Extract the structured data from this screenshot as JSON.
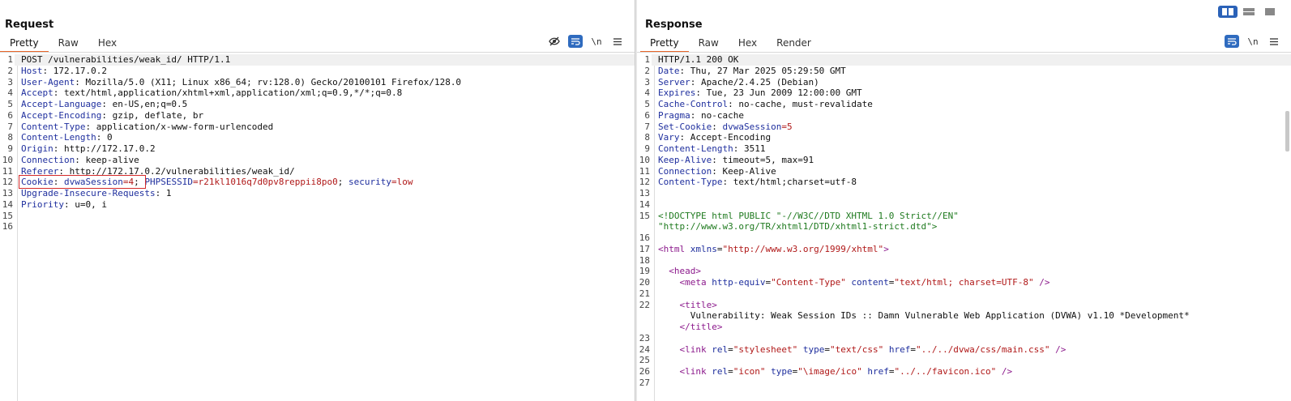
{
  "layout_toggle": [
    "split-horizontal",
    "split-vertical",
    "tabbed"
  ],
  "request": {
    "title": "Request",
    "tabs": [
      "Pretty",
      "Raw",
      "Hex"
    ],
    "active_tab": "Pretty",
    "tools": [
      "eye-slash-icon",
      "wrap-icon",
      "\\n",
      "menu-icon"
    ],
    "newline_label": "\\n",
    "lines": [
      {
        "n": "1",
        "parts": [
          {
            "t": "POST /vulnerabilities/weak_id/ HTTP/1.1",
            "c": "hv"
          }
        ]
      },
      {
        "n": "2",
        "parts": [
          {
            "t": "Host",
            "c": "hk"
          },
          {
            "t": ": 172.17.0.2",
            "c": "hv"
          }
        ]
      },
      {
        "n": "3",
        "parts": [
          {
            "t": "User-Agent",
            "c": "hk"
          },
          {
            "t": ": Mozilla/5.0 (X11; Linux x86_64; rv:128.0) Gecko/20100101 Firefox/128.0",
            "c": "hv"
          }
        ]
      },
      {
        "n": "4",
        "parts": [
          {
            "t": "Accept",
            "c": "hk"
          },
          {
            "t": ": text/html,application/xhtml+xml,application/xml;q=0.9,*/*;q=0.8",
            "c": "hv"
          }
        ]
      },
      {
        "n": "5",
        "parts": [
          {
            "t": "Accept-Language",
            "c": "hk"
          },
          {
            "t": ": en-US,en;q=0.5",
            "c": "hv"
          }
        ]
      },
      {
        "n": "6",
        "parts": [
          {
            "t": "Accept-Encoding",
            "c": "hk"
          },
          {
            "t": ": gzip, deflate, br",
            "c": "hv"
          }
        ]
      },
      {
        "n": "7",
        "parts": [
          {
            "t": "Content-Type",
            "c": "hk"
          },
          {
            "t": ": application/x-www-form-urlencoded",
            "c": "hv"
          }
        ]
      },
      {
        "n": "8",
        "parts": [
          {
            "t": "Content-Length",
            "c": "hk"
          },
          {
            "t": ": 0",
            "c": "hv"
          }
        ]
      },
      {
        "n": "9",
        "parts": [
          {
            "t": "Origin",
            "c": "hk"
          },
          {
            "t": ": http://172.17.0.2",
            "c": "hv"
          }
        ]
      },
      {
        "n": "10",
        "parts": [
          {
            "t": "Connection",
            "c": "hk"
          },
          {
            "t": ": keep-alive",
            "c": "hv"
          }
        ]
      },
      {
        "n": "11",
        "parts": [
          {
            "t": "Referer",
            "c": "hk"
          },
          {
            "t": ": http://172.17.0.2/vulnerabilities/weak_id/",
            "c": "hv"
          }
        ]
      },
      {
        "n": "12",
        "parts": [
          {
            "t": "Cookie",
            "c": "hk"
          },
          {
            "t": ": ",
            "c": "hv"
          },
          {
            "t": "dvwaSession",
            "c": "ck"
          },
          {
            "t": "=4",
            "c": "cv"
          },
          {
            "t": "; ",
            "c": "hv"
          },
          {
            "t": "PHPSESSID",
            "c": "ck"
          },
          {
            "t": "=r21kl1016q7d0pv8reppii8po0",
            "c": "cv"
          },
          {
            "t": "; ",
            "c": "hv"
          },
          {
            "t": "security",
            "c": "ck"
          },
          {
            "t": "=low",
            "c": "cv"
          }
        ]
      },
      {
        "n": "13",
        "parts": [
          {
            "t": "Upgrade-Insecure-Requests",
            "c": "hk"
          },
          {
            "t": ": 1",
            "c": "hv"
          }
        ]
      },
      {
        "n": "14",
        "parts": [
          {
            "t": "Priority",
            "c": "hk"
          },
          {
            "t": ": u=0, i",
            "c": "hv"
          }
        ]
      },
      {
        "n": "15",
        "parts": []
      },
      {
        "n": "16",
        "parts": []
      }
    ]
  },
  "response": {
    "title": "Response",
    "tabs": [
      "Pretty",
      "Raw",
      "Hex",
      "Render"
    ],
    "active_tab": "Pretty",
    "tools": [
      "wrap-icon",
      "\\n",
      "menu-icon"
    ],
    "newline_label": "\\n",
    "lines": [
      {
        "n": "1",
        "parts": [
          {
            "t": "HTTP/1.1 200 OK",
            "c": "hv"
          }
        ]
      },
      {
        "n": "2",
        "parts": [
          {
            "t": "Date",
            "c": "hk"
          },
          {
            "t": ": Thu, 27 Mar 2025 05:29:50 GMT",
            "c": "hv"
          }
        ]
      },
      {
        "n": "3",
        "parts": [
          {
            "t": "Server",
            "c": "hk"
          },
          {
            "t": ": Apache/2.4.25 (Debian)",
            "c": "hv"
          }
        ]
      },
      {
        "n": "4",
        "parts": [
          {
            "t": "Expires",
            "c": "hk"
          },
          {
            "t": ": Tue, 23 Jun 2009 12:00:00 GMT",
            "c": "hv"
          }
        ]
      },
      {
        "n": "5",
        "parts": [
          {
            "t": "Cache-Control",
            "c": "hk"
          },
          {
            "t": ": no-cache, must-revalidate",
            "c": "hv"
          }
        ]
      },
      {
        "n": "6",
        "parts": [
          {
            "t": "Pragma",
            "c": "hk"
          },
          {
            "t": ": no-cache",
            "c": "hv"
          }
        ]
      },
      {
        "n": "7",
        "parts": [
          {
            "t": "Set-Cookie",
            "c": "hk"
          },
          {
            "t": ": ",
            "c": "hv"
          },
          {
            "t": "dvwaSession",
            "c": "ck"
          },
          {
            "t": "=5",
            "c": "cv"
          }
        ]
      },
      {
        "n": "8",
        "parts": [
          {
            "t": "Vary",
            "c": "hk"
          },
          {
            "t": ": Accept-Encoding",
            "c": "hv"
          }
        ]
      },
      {
        "n": "9",
        "parts": [
          {
            "t": "Content-Length",
            "c": "hk"
          },
          {
            "t": ": 3511",
            "c": "hv"
          }
        ]
      },
      {
        "n": "10",
        "parts": [
          {
            "t": "Keep-Alive",
            "c": "hk"
          },
          {
            "t": ": timeout=5, max=91",
            "c": "hv"
          }
        ]
      },
      {
        "n": "11",
        "parts": [
          {
            "t": "Connection",
            "c": "hk"
          },
          {
            "t": ": Keep-Alive",
            "c": "hv"
          }
        ]
      },
      {
        "n": "12",
        "parts": [
          {
            "t": "Content-Type",
            "c": "hk"
          },
          {
            "t": ": text/html;charset=utf-8",
            "c": "hv"
          }
        ]
      },
      {
        "n": "13",
        "parts": []
      },
      {
        "n": "14",
        "parts": []
      },
      {
        "n": "15",
        "parts": [
          {
            "t": "<!DOCTYPE html PUBLIC \"-//W3C//DTD XHTML 1.0 Strict//EN\"",
            "c": "doc"
          }
        ]
      },
      {
        "n": "",
        "parts": [
          {
            "t": "\"http://www.w3.org/TR/xhtml1/DTD/xhtml1-strict.dtd\">",
            "c": "doc"
          }
        ]
      },
      {
        "n": "16",
        "parts": []
      },
      {
        "n": "17",
        "parts": [
          {
            "t": "<html ",
            "c": "tag"
          },
          {
            "t": "xmlns",
            "c": "attr"
          },
          {
            "t": "=",
            "c": "hv"
          },
          {
            "t": "\"http://www.w3.org/1999/xhtml\"",
            "c": "str"
          },
          {
            "t": ">",
            "c": "tag"
          }
        ]
      },
      {
        "n": "18",
        "parts": []
      },
      {
        "n": "19",
        "parts": [
          {
            "t": "  <head>",
            "c": "tag"
          }
        ]
      },
      {
        "n": "20",
        "parts": [
          {
            "t": "    <meta ",
            "c": "tag"
          },
          {
            "t": "http-equiv",
            "c": "attr"
          },
          {
            "t": "=",
            "c": "hv"
          },
          {
            "t": "\"Content-Type\"",
            "c": "str"
          },
          {
            "t": " content",
            "c": "attr"
          },
          {
            "t": "=",
            "c": "hv"
          },
          {
            "t": "\"text/html; charset=UTF-8\"",
            "c": "str"
          },
          {
            "t": " />",
            "c": "tag"
          }
        ]
      },
      {
        "n": "21",
        "parts": []
      },
      {
        "n": "22",
        "parts": [
          {
            "t": "    <title>",
            "c": "tag"
          }
        ]
      },
      {
        "n": "",
        "parts": [
          {
            "t": "      Vulnerability: Weak Session IDs :: Damn Vulnerable Web Application (DVWA) v1.10 *Development*",
            "c": "hv"
          }
        ]
      },
      {
        "n": "",
        "parts": [
          {
            "t": "    </title>",
            "c": "tag"
          }
        ]
      },
      {
        "n": "23",
        "parts": []
      },
      {
        "n": "24",
        "parts": [
          {
            "t": "    <link ",
            "c": "tag"
          },
          {
            "t": "rel",
            "c": "attr"
          },
          {
            "t": "=",
            "c": "hv"
          },
          {
            "t": "\"stylesheet\"",
            "c": "str"
          },
          {
            "t": " type",
            "c": "attr"
          },
          {
            "t": "=",
            "c": "hv"
          },
          {
            "t": "\"text/css\"",
            "c": "str"
          },
          {
            "t": " href",
            "c": "attr"
          },
          {
            "t": "=",
            "c": "hv"
          },
          {
            "t": "\"../../dvwa/css/main.css\"",
            "c": "str"
          },
          {
            "t": " />",
            "c": "tag"
          }
        ]
      },
      {
        "n": "25",
        "parts": []
      },
      {
        "n": "26",
        "parts": [
          {
            "t": "    <link ",
            "c": "tag"
          },
          {
            "t": "rel",
            "c": "attr"
          },
          {
            "t": "=",
            "c": "hv"
          },
          {
            "t": "\"icon\"",
            "c": "str"
          },
          {
            "t": " type",
            "c": "attr"
          },
          {
            "t": "=",
            "c": "hv"
          },
          {
            "t": "\"\\image/ico\"",
            "c": "str"
          },
          {
            "t": " href",
            "c": "attr"
          },
          {
            "t": "=",
            "c": "hv"
          },
          {
            "t": "\"../../favicon.ico\"",
            "c": "str"
          },
          {
            "t": " />",
            "c": "tag"
          }
        ]
      },
      {
        "n": "27",
        "parts": []
      }
    ]
  },
  "colors": {
    "accent_tab": "#e8662a",
    "button_blue": "#2f6bbf",
    "highlight_box": "#d42a2a"
  }
}
